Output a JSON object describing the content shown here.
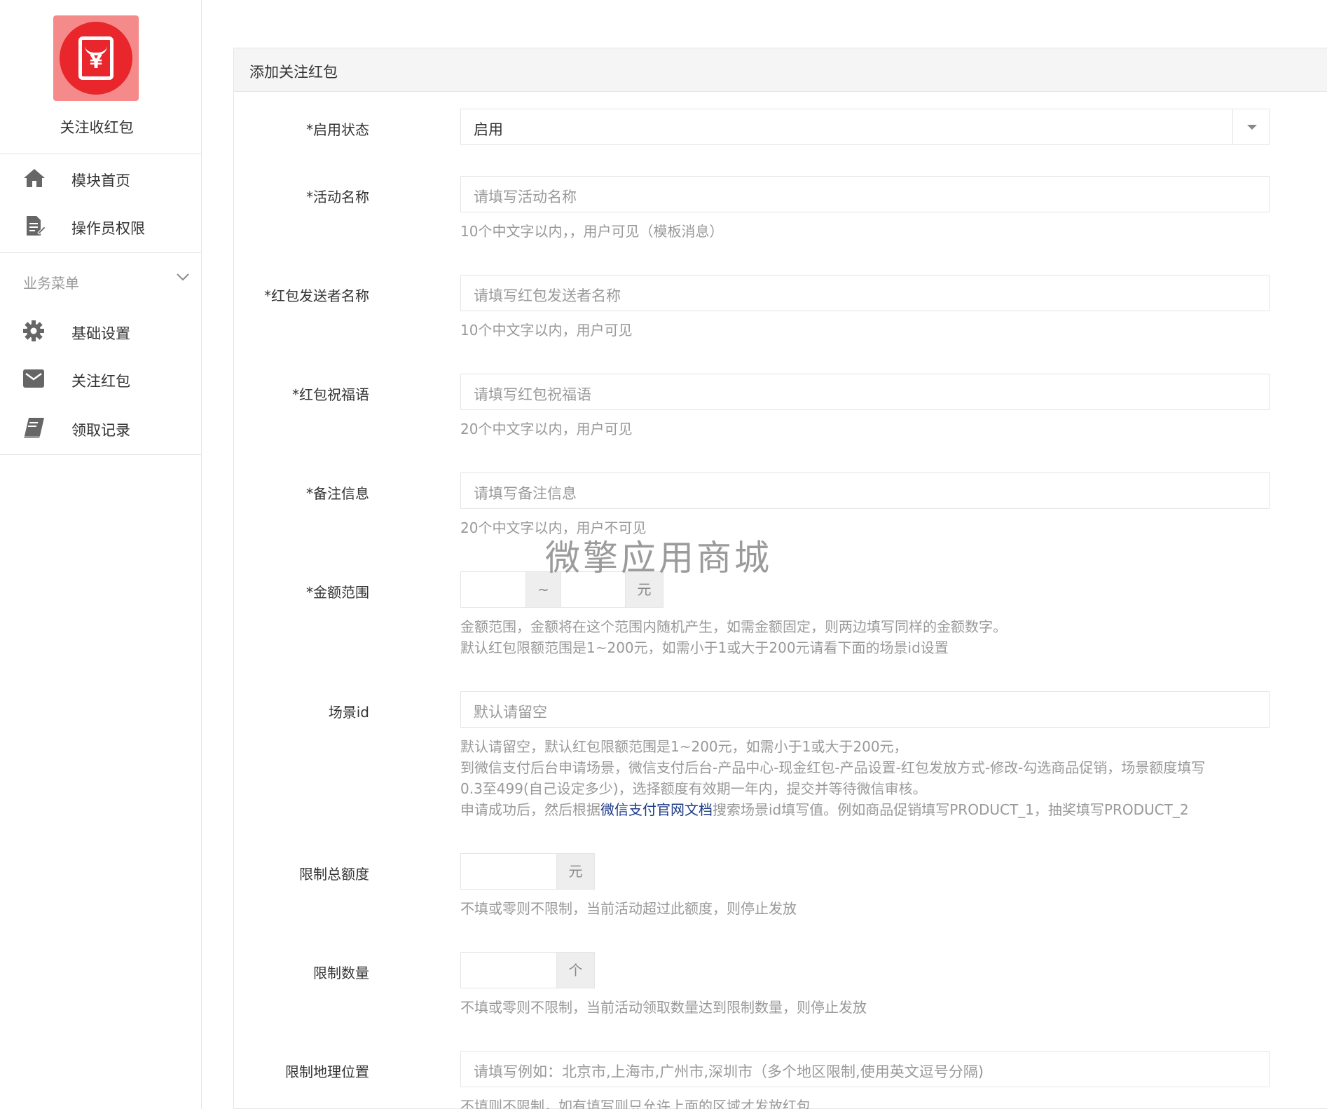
{
  "sidebar": {
    "brand_name": "关注收红包",
    "top_items": [
      {
        "label": "模块首页",
        "icon": "home-icon"
      },
      {
        "label": "操作员权限",
        "icon": "document-edit-icon"
      }
    ],
    "group_title": "业务菜单",
    "group_items": [
      {
        "label": "基础设置",
        "icon": "gear-icon"
      },
      {
        "label": "关注红包",
        "icon": "envelope-icon"
      },
      {
        "label": "领取记录",
        "icon": "book-icon"
      }
    ]
  },
  "panel": {
    "title": "添加关注红包",
    "fields": {
      "status": {
        "label": "*启用状态",
        "value": "启用"
      },
      "activity_name": {
        "label": "*活动名称",
        "placeholder": "请填写活动名称",
        "help": "10个中文字以内，，用户可见（模板消息）"
      },
      "sender_name": {
        "label": "*红包发送者名称",
        "placeholder": "请填写红包发送者名称",
        "help": "10个中文字以内，用户可见"
      },
      "wishing": {
        "label": "*红包祝福语",
        "placeholder": "请填写红包祝福语",
        "help": "20个中文字以内，用户可见"
      },
      "remark": {
        "label": "*备注信息",
        "placeholder": "请填写备注信息",
        "help": "20个中文字以内，用户不可见"
      },
      "amount_range": {
        "label": "*金额范围",
        "separator": "~",
        "unit": "元",
        "help_line1": "金额范围，金额将在这个范围内随机产生，如需金额固定，则两边填写同样的金额数字。",
        "help_line2": "默认红包限额范围是1~200元，如需小于1或大于200元请看下面的场景id设置"
      },
      "scene_id": {
        "label": "场景id",
        "placeholder": "默认请留空",
        "help_line1": "默认请留空，默认红包限额范围是1~200元，如需小于1或大于200元，",
        "help_line2": "到微信支付后台申请场景，微信支付后台-产品中心-现金红包-产品设置-红包发放方式-修改-勾选商品促销，场景额度填写",
        "help_line3": "0.3至499(自己设定多少)，选择额度有效期一年内，提交并等待微信审核。",
        "help_line4_pre": "申请成功后，然后根据",
        "help_line4_link": "微信支付官网文档",
        "help_line4_post": "搜索场景id填写值。例如商品促销填写PRODUCT_1，抽奖填写PRODUCT_2"
      },
      "total_limit": {
        "label": "限制总额度",
        "unit": "元",
        "help": "不填或零则不限制，当前活动超过此额度，则停止发放"
      },
      "count_limit": {
        "label": "限制数量",
        "unit": "个",
        "help": "不填或零则不限制，当前活动领取数量达到限制数量，则停止发放"
      },
      "geo_limit": {
        "label": "限制地理位置",
        "placeholder": "请填写例如：北京市,上海市,广州市,深圳市（多个地区限制,使用英文逗号分隔)",
        "help": "不填则不限制，如有填写则只允许上面的区域才发放红包"
      }
    }
  },
  "watermark": "微擎应用商城"
}
